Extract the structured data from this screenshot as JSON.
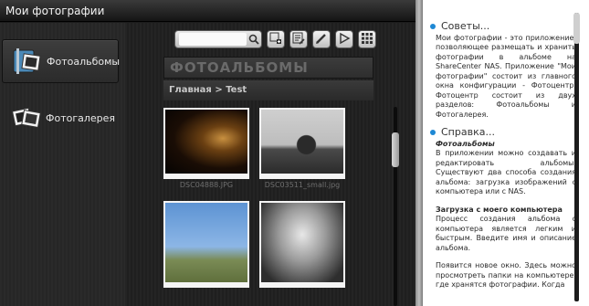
{
  "window": {
    "title": "Мои фотографии"
  },
  "sidebar": {
    "items": [
      {
        "label": "Фотоальбомы",
        "icon": "photo-album-icon",
        "active": true
      },
      {
        "label": "Фотогалерея",
        "icon": "photo-gallery-icon",
        "active": false
      }
    ]
  },
  "toolbar": {
    "search": {
      "value": "",
      "placeholder": ""
    },
    "buttons": [
      {
        "icon": "add-album-icon"
      },
      {
        "icon": "edit-album-icon"
      },
      {
        "icon": "pencil-icon"
      },
      {
        "icon": "play-slideshow-icon"
      },
      {
        "icon": "grid-view-icon"
      }
    ]
  },
  "main": {
    "heading": "ФОТОАЛЬБОМЫ",
    "breadcrumb": "Главная > Test",
    "photos": [
      {
        "caption": "DSC04888.JPG"
      },
      {
        "caption": "DSC03511_small.jpg"
      },
      {
        "caption": ""
      },
      {
        "caption": ""
      }
    ]
  },
  "help": {
    "tips_title": "Советы...",
    "tips_text": "Мои фотографии - это приложение, позволяющее размещать и хранить фотографии в альбоме на ShareCenter NAS. Приложение \"Мои фотографии\" состоит из главного окна конфигурации - Фотоцентр. Фотоцентр состоит из двух разделов: Фотоальбомы и Фотогалерея.",
    "help_title": "Справка...",
    "help_subtitle": "Фотоальбомы",
    "help_text": "В приложении можно создавать и редактировать альбомы. Существуют два способа создания альбома: загрузка изображений с компьютера или с NAS.",
    "upload_title": "Загрузка с моего компьютера",
    "upload_text": "Процесс создания альбома с компьютера является легким и быстрым. Введите имя и описание альбома.",
    "window_text": "Появится новое окно. Здесь можно просмотреть папки на компьютере, где хранятся фотографии. Когда"
  },
  "colors": {
    "accent": "#1e88d4",
    "help_bg": "#ffffff",
    "app_bg": "#1c1c1c"
  }
}
